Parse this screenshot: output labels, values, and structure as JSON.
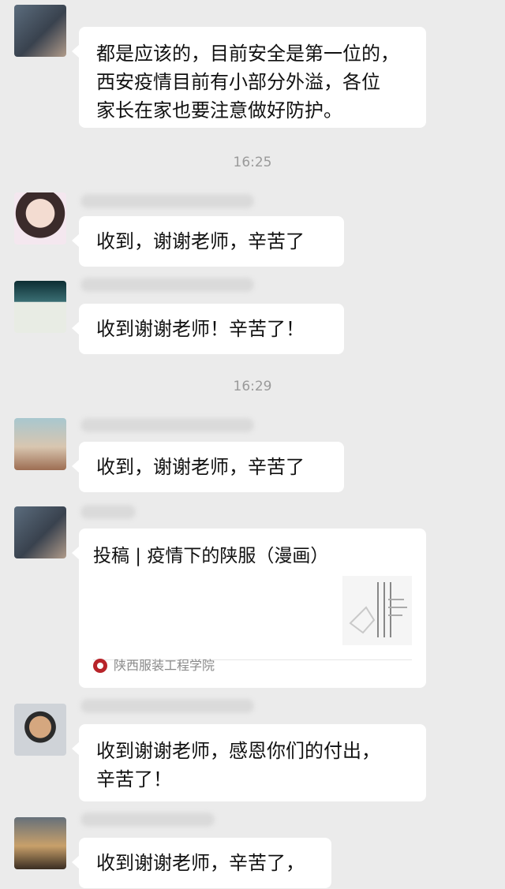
{
  "chat": {
    "messages": [
      {
        "text": "都是应该的，目前安全是第一位的，\n西安疫情目前有小部分外溢，各位\n家长在家也要注意做好防护。"
      },
      {
        "text": "收到，谢谢老师，辛苦了"
      },
      {
        "text": "收到谢谢老师！辛苦了！"
      },
      {
        "text": "收到，谢谢老师，辛苦了"
      },
      {
        "text": "收到谢谢老师，感恩你们的付出，\n辛苦了！"
      },
      {
        "text": "收到谢谢老师，辛苦了，"
      }
    ],
    "times": [
      "16:25",
      "16:29"
    ],
    "share_card": {
      "title": "投稿 | 疫情下的陕服（漫画）",
      "source": "陕西服装工程学院",
      "source_logo_color": "#b8242a"
    }
  }
}
